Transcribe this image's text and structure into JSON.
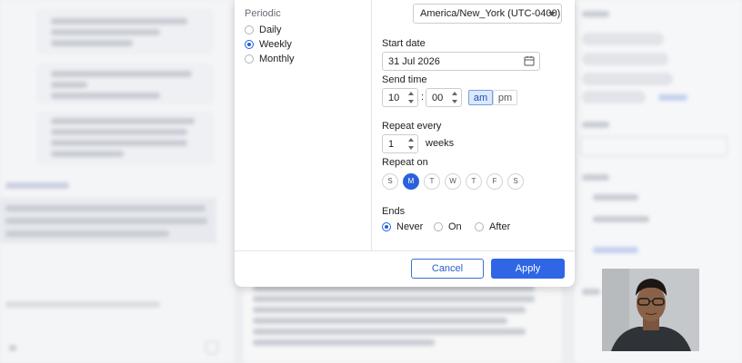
{
  "modal": {
    "periodic_label": "Periodic",
    "periodic_options": [
      "Daily",
      "Weekly",
      "Monthly"
    ],
    "periodic_selected": "Weekly",
    "timezone": "America/New_York (UTC-0400)",
    "start_date_label": "Start date",
    "start_date": "31 Jul 2026",
    "send_time_label": "Send time",
    "hour": "10",
    "minute": "00",
    "time_separator": ":",
    "am_label": "am",
    "pm_label": "pm",
    "am_pm_selected": "am",
    "repeat_every_label": "Repeat every",
    "repeat_every_value": "1",
    "repeat_unit": "weeks",
    "repeat_on_label": "Repeat on",
    "days": [
      "S",
      "M",
      "T",
      "W",
      "T",
      "F",
      "S"
    ],
    "selected_day_index": 1,
    "ends_label": "Ends",
    "ends_options": [
      "Never",
      "On",
      "After"
    ],
    "ends_selected": "Never",
    "cancel_label": "Cancel",
    "apply_label": "Apply"
  },
  "colors": {
    "accent": "#2e66e6",
    "selected_day": "#2a62db",
    "am_selected_bg": "#dce8fb"
  }
}
